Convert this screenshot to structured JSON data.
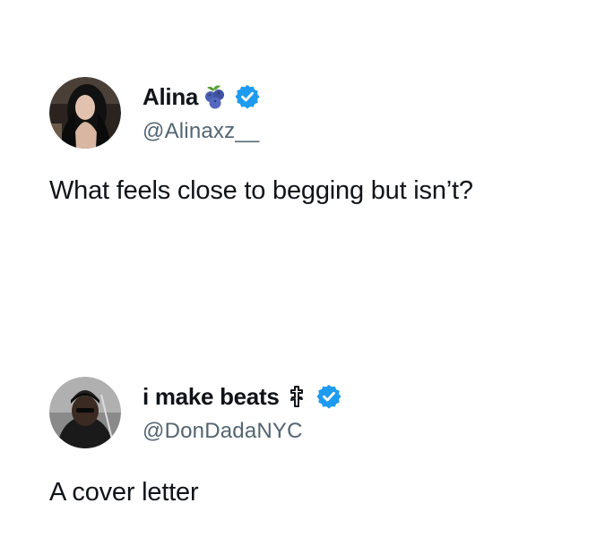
{
  "tweets": [
    {
      "display_name": "Alina",
      "emoji_icon": "blueberries-icon",
      "verified_icon": "verified-badge-icon",
      "handle": "@Alinaxz__",
      "text": "What feels close to begging but isn’t?"
    },
    {
      "display_name": "i make beats",
      "emoji_icon": "orthodox-cross-icon",
      "verified_icon": "verified-badge-icon",
      "handle": "@DonDadaNYC",
      "text": "A cover letter"
    }
  ],
  "colors": {
    "text": "#0f1419",
    "handle": "#536471",
    "verified": "#1d9bf0",
    "background": "#ffffff"
  }
}
